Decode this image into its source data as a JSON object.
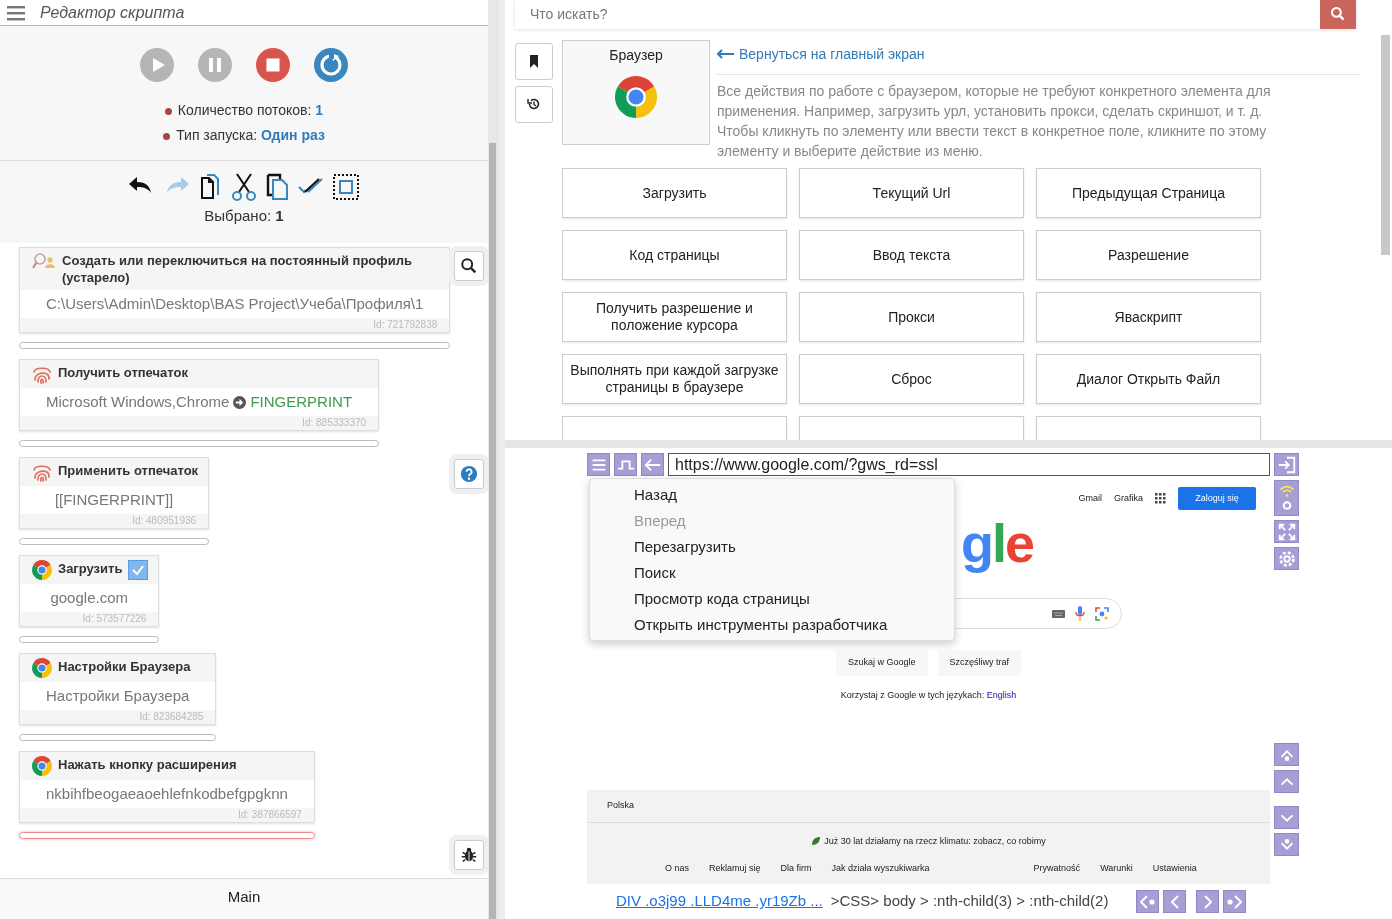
{
  "app_title": "Редактор скрипта",
  "run_controls": [
    {
      "kind": "play",
      "disabled": true
    },
    {
      "kind": "pause",
      "disabled": true
    },
    {
      "kind": "stop",
      "disabled": false
    },
    {
      "kind": "restart",
      "disabled": false
    }
  ],
  "run_info": [
    {
      "label": "Количество потоков:",
      "value": "1"
    },
    {
      "label": "Тип запуска:",
      "value": "Один раз"
    }
  ],
  "edit_tools": [
    {
      "kind": "undo",
      "disabled": false
    },
    {
      "kind": "redo",
      "disabled": true
    },
    {
      "kind": "copy",
      "disabled": false
    },
    {
      "kind": "cut",
      "disabled": false
    },
    {
      "kind": "paste",
      "disabled": false
    },
    {
      "kind": "select-all",
      "disabled": false
    },
    {
      "kind": "select-area",
      "disabled": false
    }
  ],
  "selected_count": {
    "label": "Выбрано:",
    "value": "1"
  },
  "actions": [
    {
      "kind": "profile",
      "title": "Создать или переключиться на постоянный профиль (устарело)",
      "value": "C:\\Users\\Admin\\Desktop\\BAS Project\\Учеба\\Профиля\\1",
      "id": "Id: 721792838",
      "selected": false,
      "insert_point": false
    },
    {
      "kind": "fingerprint",
      "title": "Получить отпечаток",
      "value": "Microsoft Windows,Chrome",
      "output": "FINGERPRINT",
      "id": "Id: 885333370",
      "selected": false,
      "insert_point": false
    },
    {
      "kind": "fingerprint",
      "title": "Применить отпечаток",
      "value": "[[FINGERPRINT]]",
      "id": "Id: 480951936",
      "selected": false,
      "insert_point": false
    },
    {
      "kind": "chrome",
      "title": "Загрузить",
      "value": "google.com",
      "id": "Id: 573577226",
      "selected": true,
      "insert_point": false
    },
    {
      "kind": "chrome",
      "title": "Настройки Браузера",
      "value": "Настройки Браузера",
      "id": "Id: 823684285",
      "selected": false,
      "insert_point": false
    },
    {
      "kind": "chrome",
      "title": "Нажать кнопку расширения",
      "value": "nkbihfbeogaeaoehlefnkodbefgpgknn",
      "id": "Id: 387866597",
      "selected": false,
      "insert_point": true
    }
  ],
  "side_tools": [
    {
      "kind": "search"
    },
    {
      "kind": "help"
    },
    {
      "kind": "debug"
    }
  ],
  "function_tab": "Main",
  "palette": {
    "search": {
      "placeholder": "Что искать?"
    },
    "tools": [
      {
        "kind": "bookmark"
      },
      {
        "kind": "history"
      }
    ],
    "category": {
      "title": "Браузер"
    },
    "back_link": "Вернуться на главный экран",
    "description": "Все действия по работе с браузером, которые не требуют конкретного элемента для применения. Например, загрузить урл, установить прокси, сделать скриншот, и т. д. Чтобы кликнуть по элементу или ввести текст в конкретное поле, кликните по этому элементу и выберите действие из меню.",
    "actions": [
      "Загрузить",
      "Текущий Url",
      "Предыдущая Страница",
      "Код страницы",
      "Ввод текста",
      "Разрешение",
      "Получить разрешение и положение курсора",
      "Прокси",
      "Яваскрипт",
      "Выполнять при каждой загрузке страницы в браузере",
      "Сброс",
      "Диалог Открыть Файл"
    ]
  },
  "browser": {
    "url": "https://www.google.com/?gws_rd=ssl",
    "menu": [
      {
        "label": "Назад",
        "disabled": false
      },
      {
        "label": "Вперед",
        "disabled": true
      },
      {
        "label": "Перезагрузить",
        "disabled": false
      },
      {
        "label": "Поиск",
        "disabled": false
      },
      {
        "label": "Просмотр кода страницы",
        "disabled": false
      },
      {
        "label": "Открыть инструменты разработчика",
        "disabled": false
      }
    ],
    "page": {
      "header_links": [
        "Gmail",
        "Grafika"
      ],
      "sign_in": "Zaloguj się",
      "logo_text": "gle",
      "buttons": [
        "Szukaj w Google",
        "Szczęśliwy traf"
      ],
      "languages_label": "Korzystaj z Google w tych językach:",
      "language_link": "English",
      "country": "Polska",
      "climate": "Już 30 lat działamy na rzecz klimatu: zobacz, co robimy",
      "footer_left": [
        "O nas",
        "Reklamuj się",
        "Dla firm",
        "Jak działa wyszukiwarka"
      ],
      "footer_right": [
        "Prywatność",
        "Warunki",
        "Ustawienia"
      ]
    },
    "selector_path": "DIV .o3j99 .LLD4me .yr19Zb ...",
    "css_path": ">CSS> body > :nth-child(3) > :nth-child(2)"
  }
}
